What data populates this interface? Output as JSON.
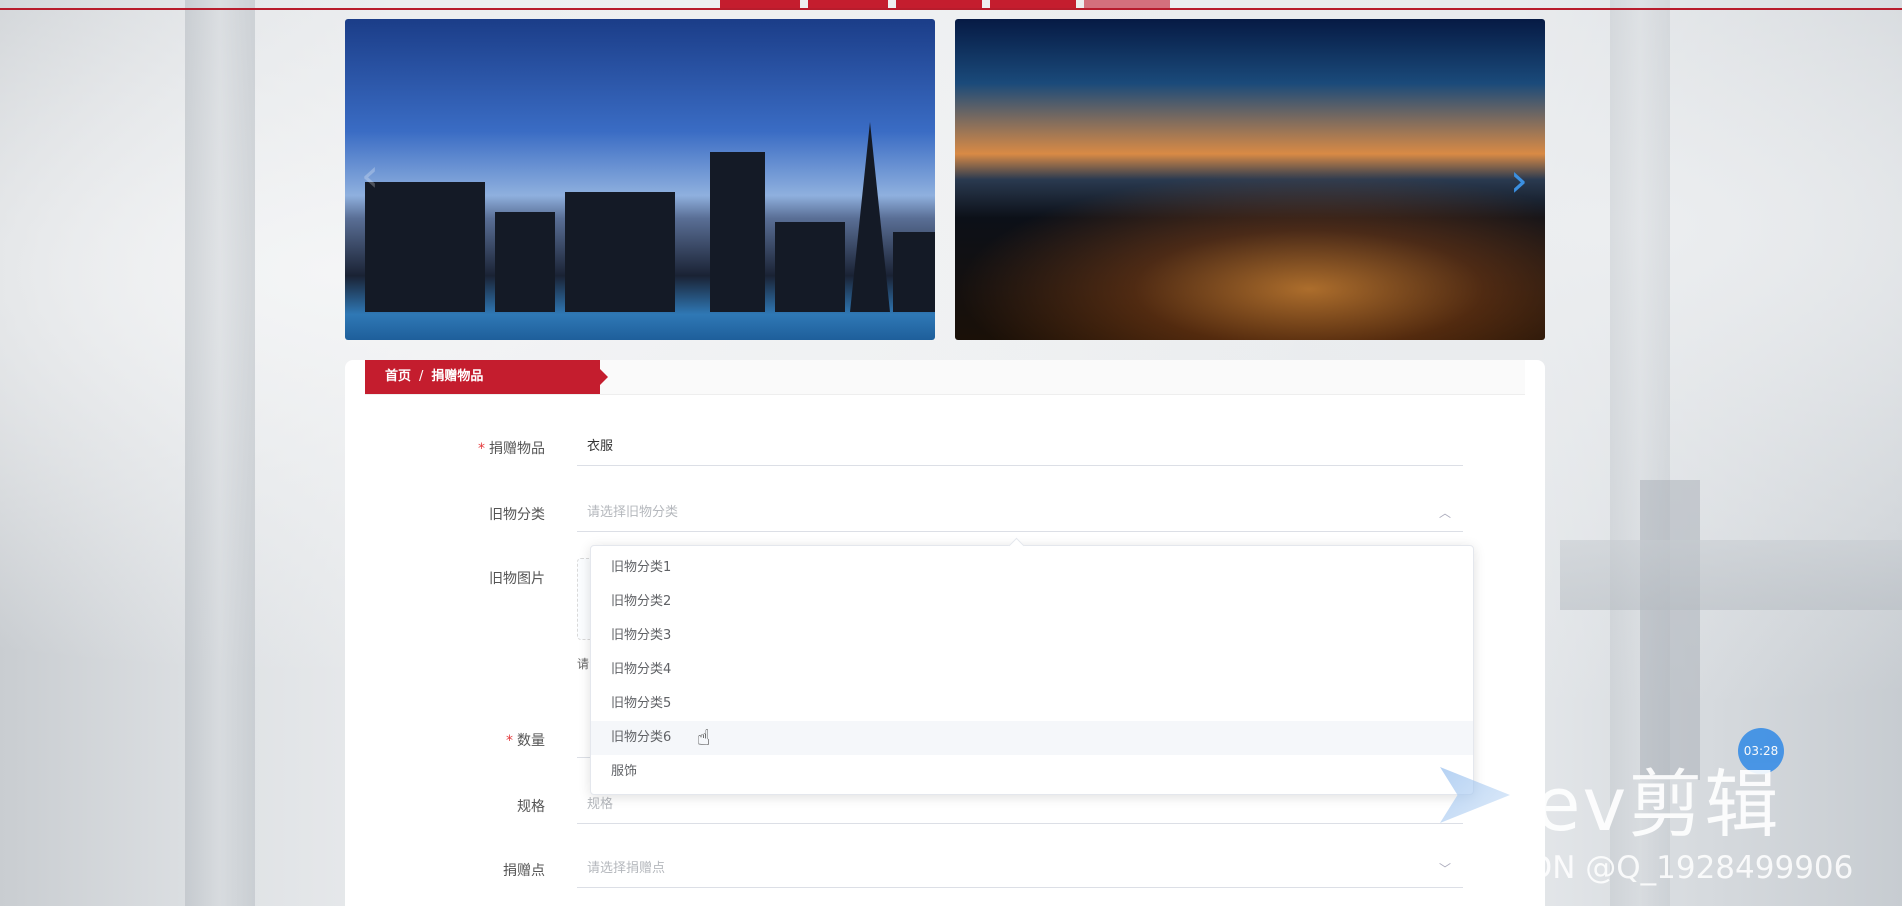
{
  "nav": {
    "tabs": [
      "",
      "",
      "",
      "",
      ""
    ]
  },
  "breadcrumb": {
    "home": "首页",
    "separator": "/",
    "current": "捐赠物品"
  },
  "form": {
    "item": {
      "label": "捐赠物品",
      "required": true,
      "value": "衣服"
    },
    "category": {
      "label": "旧物分类",
      "placeholder": "请选择旧物分类"
    },
    "image": {
      "label": "旧物图片",
      "hint": "请"
    },
    "quantity": {
      "label": "数量",
      "required": true
    },
    "spec": {
      "label": "规格",
      "placeholder": "规格"
    },
    "point": {
      "label": "捐赠点",
      "placeholder": "请选择捐赠点"
    }
  },
  "dropdown": {
    "options": [
      "旧物分类1",
      "旧物分类2",
      "旧物分类3",
      "旧物分类4",
      "旧物分类5",
      "旧物分类6",
      "服饰"
    ],
    "hovered_index": 5
  },
  "watermark": {
    "timer": "03:28",
    "brand": "ev剪辑",
    "credit": "CSDN @Q_1928499906"
  },
  "colors": {
    "accent": "#c41d2e",
    "arrow": "#3b8fe0"
  }
}
